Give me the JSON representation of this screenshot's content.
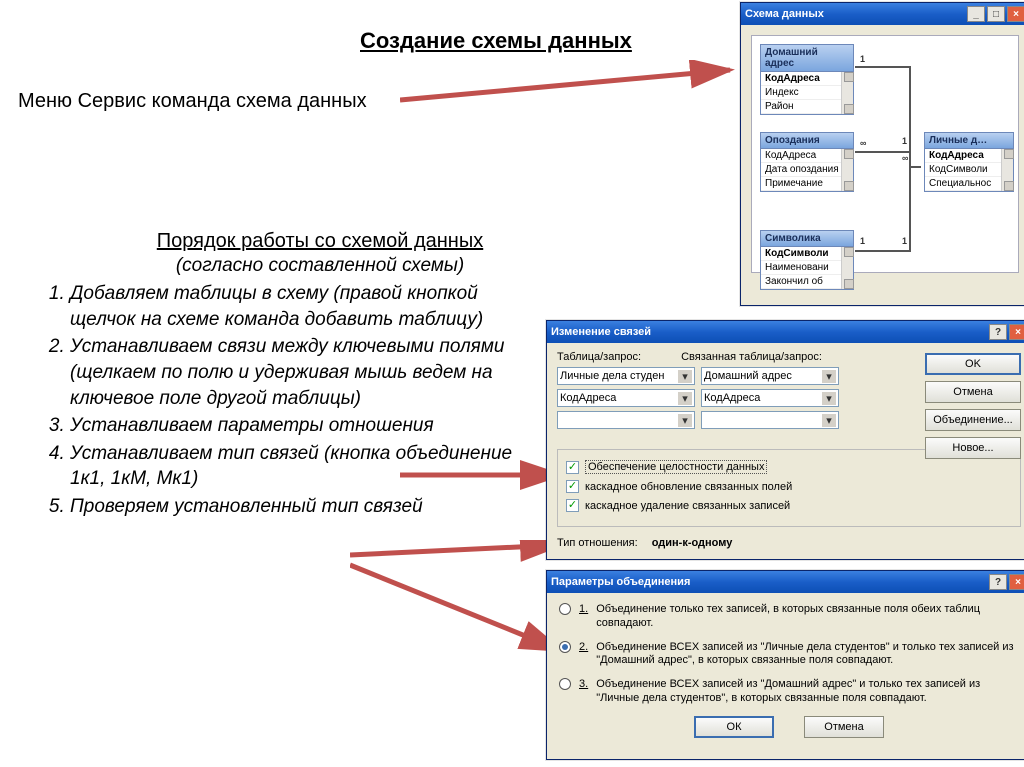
{
  "title": "Создание схемы данных",
  "menu_line": "Меню Сервис команда схема данных",
  "workflow": {
    "heading": "Порядок работы со схемой данных",
    "sub": "(согласно составленной схемы)",
    "steps": [
      "Добавляем таблицы в схему (правой кнопкой щелчок на схеме команда добавить таблицу)",
      " Устанавливаем связи между ключевыми полями (щелкаем по полю и удерживая мышь ведем на ключевое поле другой таблицы)",
      "Устанавливаем параметры отношения",
      "Устанавливаем тип связей (кнопка объединение 1к1, 1кМ, Мк1)",
      "Проверяем установленный тип связей"
    ]
  },
  "schema_window": {
    "title": "Схема данных",
    "btn_min": "_",
    "btn_max": "□",
    "btn_close": "×",
    "tables": {
      "home_addr": {
        "title": "Домашний адрес",
        "fields": [
          "КодАдреса",
          "Индекс",
          "Район"
        ]
      },
      "late": {
        "title": "Опоздания",
        "fields": [
          "КодАдреса",
          "Дата опоздания",
          "Примечание"
        ]
      },
      "symbol": {
        "title": "Символика",
        "fields": [
          "КодСимволи",
          "Наименовани",
          "Закончил об"
        ]
      },
      "personal": {
        "title": "Личные д…",
        "fields": [
          "КодАдреса",
          "КодСимволи",
          "Специальнос"
        ]
      }
    },
    "rel": {
      "one": "1",
      "inf": "∞"
    }
  },
  "edit_window": {
    "title": "Изменение связей",
    "help_icon": "?",
    "close_icon": "×",
    "label_table": "Таблица/запрос:",
    "label_related": "Связанная таблица/запрос:",
    "combo_left_table": "Личные дела студен",
    "combo_right_table": "Домашний адрес",
    "combo_left_field": "КодАдреса",
    "combo_right_field": "КодАдреса",
    "chk_integrity": "Обеспечение целостности данных",
    "chk_cascade_update": "каскадное обновление связанных полей",
    "chk_cascade_delete": "каскадное удаление связанных записей",
    "rel_type_label": "Тип отношения:",
    "rel_type_value": "один-к-одному",
    "buttons": {
      "ok": "OK",
      "cancel": "Отмена",
      "join": "Объединение...",
      "new": "Новое..."
    }
  },
  "join_window": {
    "title": "Параметры объединения",
    "help_icon": "?",
    "close_icon": "×",
    "opts": [
      {
        "num": "1.",
        "text": "Объединение только тех записей, в которых связанные поля обеих таблиц совпадают."
      },
      {
        "num": "2.",
        "text": "Объединение ВСЕХ записей из \"Личные дела студентов\" и только тех записей из \"Домашний адрес\", в которых связанные поля совпадают."
      },
      {
        "num": "3.",
        "text": "Объединение ВСЕХ записей из \"Домашний адрес\" и только тех записей из \"Личные дела студентов\", в которых связанные поля совпадают."
      }
    ],
    "ok": "ОК",
    "cancel": "Отмена"
  }
}
